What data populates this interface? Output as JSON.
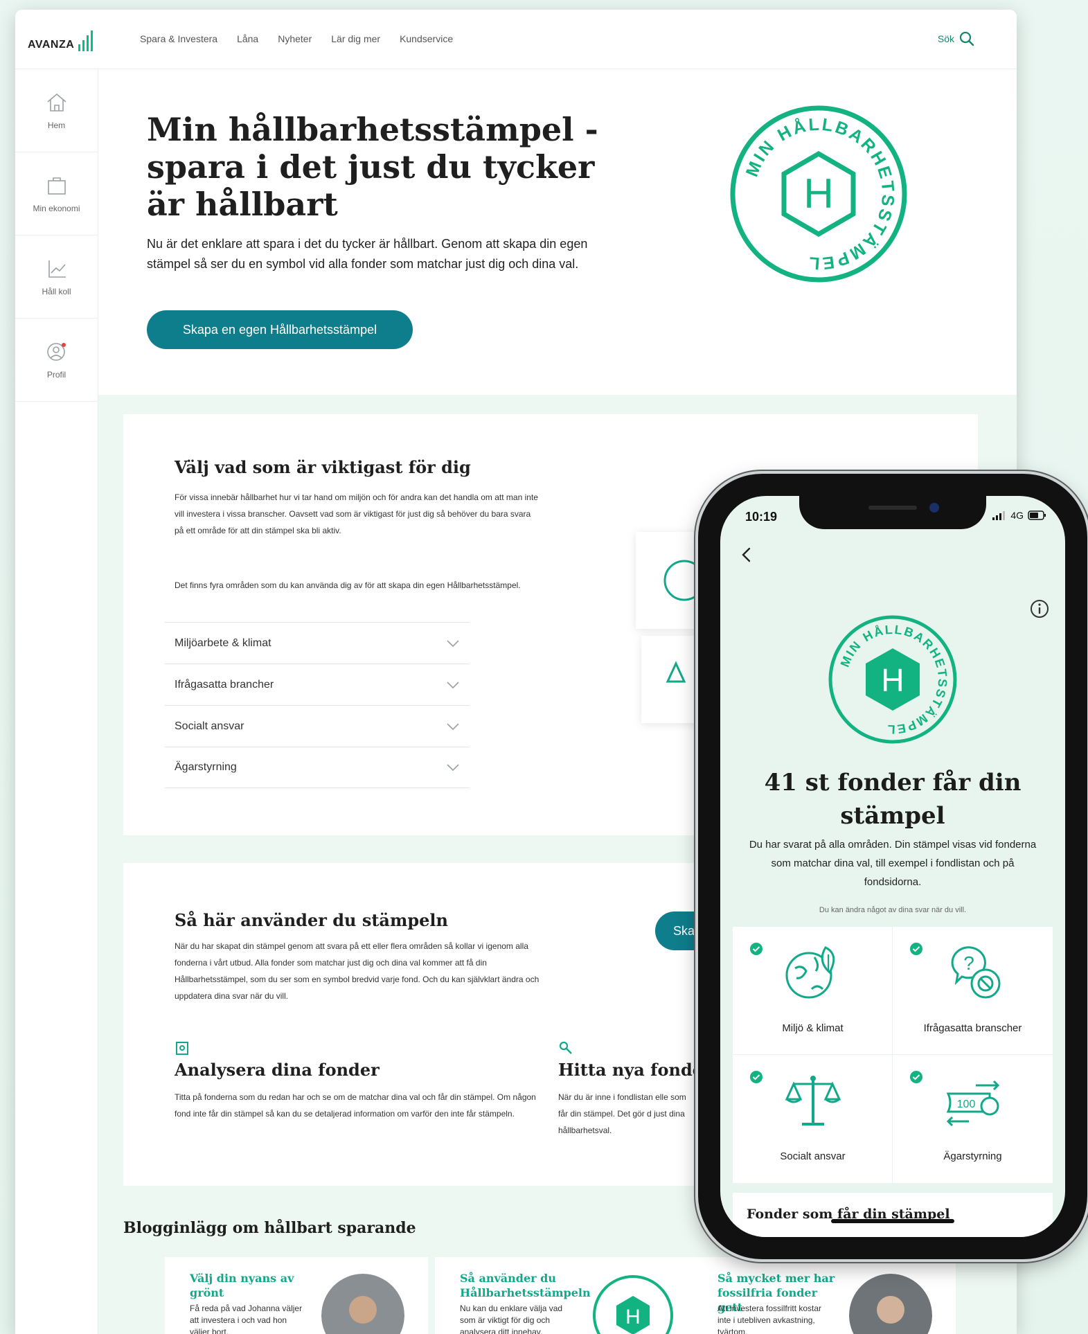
{
  "brand": {
    "logo_text": "AVANZA",
    "accent": "#00c281",
    "teal": "#0e7d8c",
    "green": "#12a88a"
  },
  "nav": {
    "links": [
      "Spara & Investera",
      "Låna",
      "Nyheter",
      "Lär dig mer",
      "Kundservice"
    ],
    "search_label": "Sök"
  },
  "sidebar": {
    "items": [
      {
        "label": "Hem",
        "icon": "home-icon"
      },
      {
        "label": "Min ekonomi",
        "icon": "briefcase-icon"
      },
      {
        "label": "Håll koll",
        "icon": "chart-icon"
      },
      {
        "label": "Profil",
        "icon": "profile-icon"
      }
    ]
  },
  "hero": {
    "title": "Min hållbarhetsstämpel - spara i det just du tycker är hållbart",
    "text": "Nu är det enklare att spara i det du tycker är hållbart. Genom att skapa din egen stämpel så ser du en symbol vid alla fonder som matchar just dig och dina val.",
    "cta": "Skapa en egen Hållbarhetsstämpel"
  },
  "stamp": {
    "ring_text": "MIN HÅLLBARHETSSTÄMPEL",
    "letter": "H"
  },
  "choose": {
    "title": "Välj vad som är viktigast för dig",
    "p1": "För vissa innebär hållbarhet hur vi tar hand om miljön och för andra kan det handla om att man inte vill investera i vissa branscher. Oavsett vad som är viktigast för just dig så behöver du bara svara på ett område för att din stämpel ska bli aktiv.",
    "p2": "Det finns fyra områden som du kan använda dig av för att skapa din egen Hållbarhetsstämpel.",
    "accordion": [
      "Miljöarbete & klimat",
      "Ifrågasatta brancher",
      "Socialt ansvar",
      "Ägarstyrning"
    ]
  },
  "usage": {
    "title": "Så här använder du stämpeln",
    "text": "När du har skapat din stämpel genom att svara på ett eller flera områden så kollar vi igenom alla fonderna i vårt utbud. Alla fonder som matchar just dig och dina val kommer att få din Hållbarhetsstämpel, som du ser som en symbol bredvid varje fond. Och du kan självklart ändra och uppdatera dina svar när du vill.",
    "button": "Skap",
    "features": [
      {
        "title": "Analysera dina fonder",
        "text": "Titta på fonderna som du redan har och se om de matchar dina val och får din stämpel. Om någon fond inte får din stämpel så kan du se detaljerad information om varför den inte får stämpeln."
      },
      {
        "title": "Hitta nya fonder",
        "text": "När du är inne i fondlistan elle som får din stämpel. Det gör d just dina hållbarhetsval."
      }
    ]
  },
  "blog": {
    "heading": "Blogginlägg om hållbart sparande",
    "posts": [
      {
        "title": "Välj din nyans av grönt",
        "text": "Få reda på vad Johanna väljer att investera i och vad hon väljer bort."
      },
      {
        "title": "Så använder du Hållbarhetsstämpeln",
        "text": "Nu kan du enklare välja vad som är viktigt för dig och analysera ditt innehav."
      },
      {
        "title": "Så mycket mer har fossilfria fonder gett",
        "text": "Att investera fossilfritt kostar inte i utebliven avkastning, tvärtom."
      }
    ]
  },
  "phone": {
    "time": "10:19",
    "network": "4G",
    "title": "41 st fonder får din stämpel",
    "text": "Du har svarat på alla områden. Din stämpel visas vid fonderna som matchar dina val, till exempel i fondlistan och på fondsidorna.",
    "small": "Du kan ändra något av dina svar när du vill.",
    "categories": [
      {
        "label": "Miljö & klimat",
        "icon": "globe-leaf-icon"
      },
      {
        "label": "Ifrågasatta branscher",
        "icon": "question-block-icon"
      },
      {
        "label": "Socialt ansvar",
        "icon": "scales-icon"
      },
      {
        "label": "Ägarstyrning",
        "icon": "money-arrows-icon"
      }
    ],
    "bottom_title": "Fonder som får din stämpel",
    "stamp_note": "100"
  }
}
